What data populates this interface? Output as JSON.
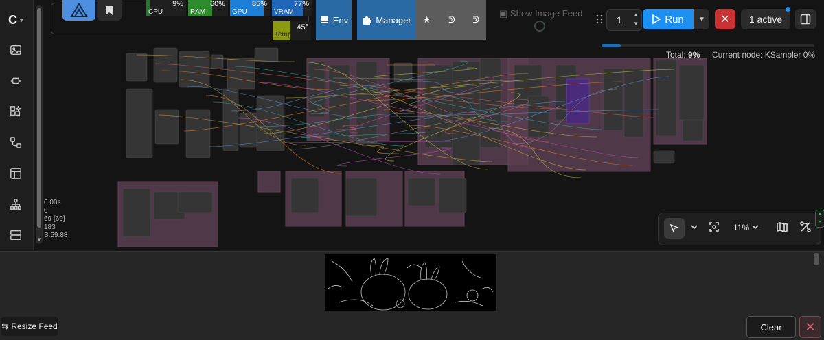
{
  "sidebar": {
    "logo": "C",
    "items": [
      {
        "name": "images-icon"
      },
      {
        "name": "models-icon"
      },
      {
        "name": "nodes-library-icon"
      },
      {
        "name": "workflows-icon"
      },
      {
        "name": "templates-icon"
      },
      {
        "name": "node-map-icon"
      },
      {
        "name": "queue-icon"
      }
    ]
  },
  "monitor": {
    "cpu": {
      "label": "CPU",
      "value": "9%",
      "fill": 0.09,
      "color": "#1f7a26"
    },
    "ram": {
      "label": "RAM",
      "value": "60%",
      "fill": 0.6,
      "color": "#2d8a2d"
    },
    "gpu": {
      "label": "GPU",
      "value": "85%",
      "fill": 0.85,
      "color": "#1e7fd8"
    },
    "vram": {
      "label": "VRAM",
      "value": "77%",
      "fill": 0.77,
      "color": "#2066b8"
    },
    "temp": {
      "label": "Temp",
      "value": "45°"
    }
  },
  "toolbar": {
    "env_label": "Env",
    "manager_label": "Manager",
    "show_feed_label": "Show Image Feed",
    "queue_count": "1",
    "run_label": "Run",
    "active_label": "1 active"
  },
  "progress": {
    "fill": 0.09,
    "total_label": "Total:",
    "total_value": "9%",
    "current_label": "Current node: KSampler 0%"
  },
  "stats": {
    "line1": "0.00s",
    "line2": "0",
    "line3": "69 [69]",
    "line4": "183",
    "line5": "S:59.88"
  },
  "canvas_tools": {
    "zoom": "11%"
  },
  "feed": {
    "resize_label": "Resize Feed",
    "clear_label": "Clear"
  },
  "colors": {
    "accent": "#1d8ff0",
    "danger": "#c83232",
    "group": "#5a3a4e"
  }
}
